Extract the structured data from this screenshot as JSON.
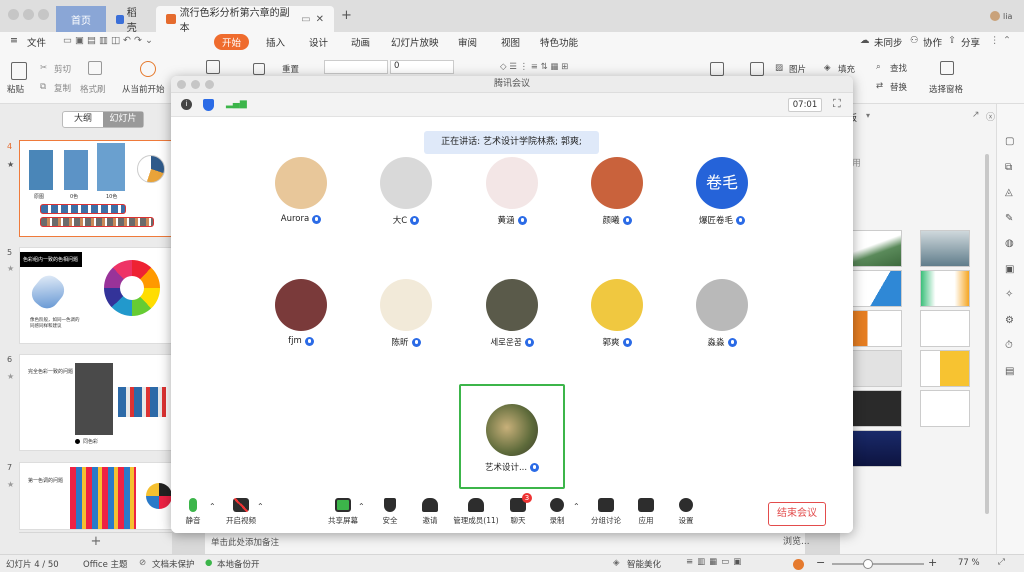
{
  "tabs": {
    "home": "首页",
    "daoke": "稻壳",
    "doc": "流行色彩分析第六章的副本"
  },
  "user_initial": "lia",
  "menu": {
    "file": "文件",
    "items": [
      "开始",
      "插入",
      "设计",
      "动画",
      "幻灯片放映",
      "审阅",
      "视图",
      "特色功能"
    ],
    "right": [
      "未同步",
      "协作",
      "分享"
    ]
  },
  "ribbon": {
    "paste": "粘贴",
    "cut": "剪切",
    "copy": "复制",
    "format_painter": "格式刷",
    "from_start": "从当前开始",
    "reset": "重置",
    "font_size": "0",
    "picture": "图片",
    "fill": "填充",
    "find": "查找",
    "replace": "替换",
    "select_pane": "选择窗格"
  },
  "leftpane": {
    "outline_tab": "大纲",
    "slides_tab": "幻灯片",
    "slide_nums": [
      "4",
      "5",
      "6",
      "7"
    ],
    "s5_title": "色彩组内一致的色相问题",
    "s5_text": "像色阶般，如同一色调的同感同样和建议",
    "s6_title": "完全色彩一致的问题",
    "s6_caption": "同色彩",
    "s7_title": "第一色调的问题",
    "s4_labels": [
      "原图",
      "0色",
      "10色"
    ],
    "add": "+"
  },
  "meeting": {
    "title": "腾讯会议",
    "timer": "07:01",
    "speaking": "正在讲话: 艺术设计学院林燕; 郭爽;",
    "participants": [
      {
        "name": "Aurora",
        "color": "#e8c79a"
      },
      {
        "name": "大C",
        "color": "#d9d9d9"
      },
      {
        "name": "黄涵",
        "color": "#f3e6e6"
      },
      {
        "name": "颜曦",
        "color": "#c9623c"
      },
      {
        "name": "爆匠卷毛",
        "color": "#2563d9",
        "text": "卷毛"
      },
      {
        "name": "fjm",
        "color": "#7a3a3a"
      },
      {
        "name": "陈昕",
        "color": "#f2ead9"
      },
      {
        "name": "세로운꿈",
        "color": "#5a5a4a"
      },
      {
        "name": "郭爽",
        "color": "#f0c840"
      },
      {
        "name": "淼淼",
        "color": "#b9b9b9"
      }
    ],
    "self_name": "艺术设计...",
    "toolbar": {
      "mute": "静音",
      "video": "开启视频",
      "share": "共享屏幕",
      "security": "安全",
      "invite": "邀请",
      "manage": "管理成员(11)",
      "chat": "聊天",
      "chat_badge": "3",
      "record": "录制",
      "breakout": "分组讨论",
      "apps": "应用",
      "settings": "设置",
      "end": "结束会议"
    }
  },
  "rightpane": {
    "header": "板",
    "sub": "用",
    "browse": "浏览..."
  },
  "notes": "单击此处添加备注",
  "status": {
    "slide": "幻灯片 4 / 50",
    "theme": "Office 主题",
    "protect": "文档未保护",
    "backup": "本地备份开",
    "beautify": "智能美化",
    "zoom": "77 %"
  }
}
